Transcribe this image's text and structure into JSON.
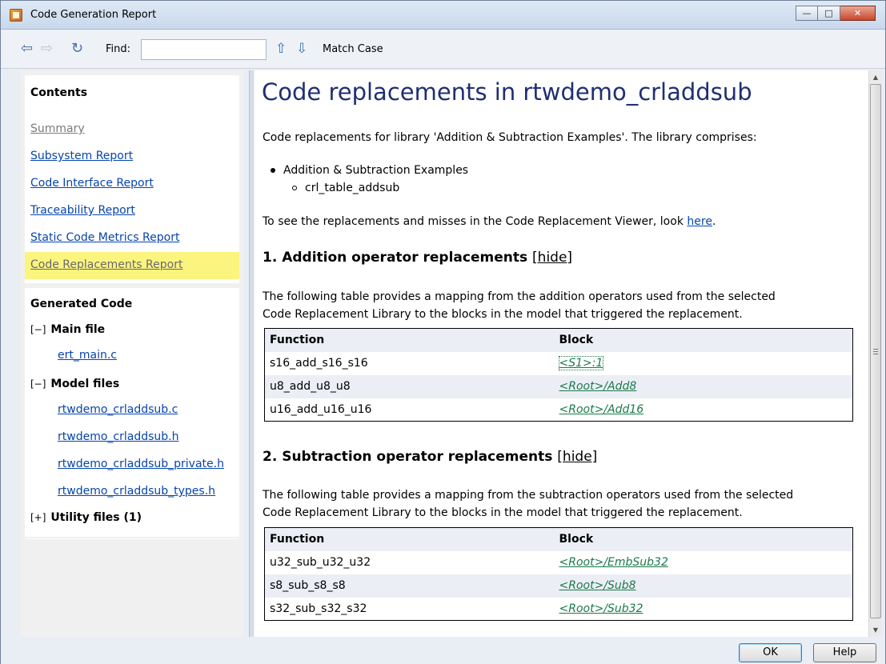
{
  "window": {
    "title": "Code Generation Report"
  },
  "toolbar": {
    "find_label": "Find:",
    "find_value": "",
    "match_case": "Match Case",
    "icons": [
      "back-arrow-icon",
      "forward-arrow-icon",
      "refresh-icon",
      "find-previous-icon",
      "find-next-icon"
    ]
  },
  "sidebar": {
    "contents_title": "Contents",
    "links": [
      {
        "label": "Summary",
        "state": "visited"
      },
      {
        "label": "Subsystem Report",
        "state": "normal"
      },
      {
        "label": "Code Interface Report",
        "state": "normal"
      },
      {
        "label": "Traceability Report",
        "state": "normal"
      },
      {
        "label": "Static Code Metrics Report",
        "state": "normal"
      },
      {
        "label": "Code Replacements Report",
        "state": "active"
      }
    ],
    "generated_code": {
      "title": "Generated Code",
      "main_file": {
        "toggle": "[−]",
        "label": "Main file",
        "files": [
          "ert_main.c"
        ]
      },
      "model_files": {
        "toggle": "[−]",
        "label": "Model files",
        "files": [
          "rtwdemo_crladdsub.c",
          "rtwdemo_crladdsub.h",
          "rtwdemo_crladdsub_private.h",
          "rtwdemo_crladdsub_types.h"
        ]
      },
      "utility_files": {
        "toggle": "[+]",
        "label": "Utility files (1)"
      }
    }
  },
  "main": {
    "title": "Code replacements in rtwdemo_crladdsub",
    "intro": "Code replacements for library 'Addition & Subtraction Examples'. The library comprises:",
    "library": "Addition & Subtraction Examples",
    "table_name": "crl_table_addsub",
    "viewer_text": "To see the replacements and misses in the Code Replacement Viewer, look",
    "viewer_link": "here",
    "viewer_end": ".",
    "sections": [
      {
        "heading": "1. Addition operator replacements",
        "hide": "[hide]",
        "desc_line1": "The following table provides a mapping from the addition operators used from the selected",
        "desc_line2": "Code Replacement Library to the blocks in the model that triggered the replacement.",
        "headers": [
          "Function",
          "Block"
        ],
        "rows": [
          [
            "s16_add_s16_s16",
            "<S1>:1"
          ],
          [
            "u8_add_u8_u8",
            "<Root>/Add8"
          ],
          [
            "u16_add_u16_u16",
            "<Root>/Add16"
          ]
        ]
      },
      {
        "heading": "2. Subtraction operator replacements",
        "hide": "[hide]",
        "desc_line1": "The following table provides a mapping from the subtraction operators used from the selected",
        "desc_line2": "Code Replacement Library to the blocks in the model that triggered the replacement.",
        "headers": [
          "Function",
          "Block"
        ],
        "rows": [
          [
            "u32_sub_u32_u32",
            "<Root>/EmbSub32"
          ],
          [
            "s8_sub_s8_s8",
            "<Root>/Sub8"
          ],
          [
            "s32_sub_s32_s32",
            "<Root>/Sub32"
          ]
        ]
      }
    ]
  },
  "footer": {
    "ok": "OK",
    "help": "Help"
  }
}
